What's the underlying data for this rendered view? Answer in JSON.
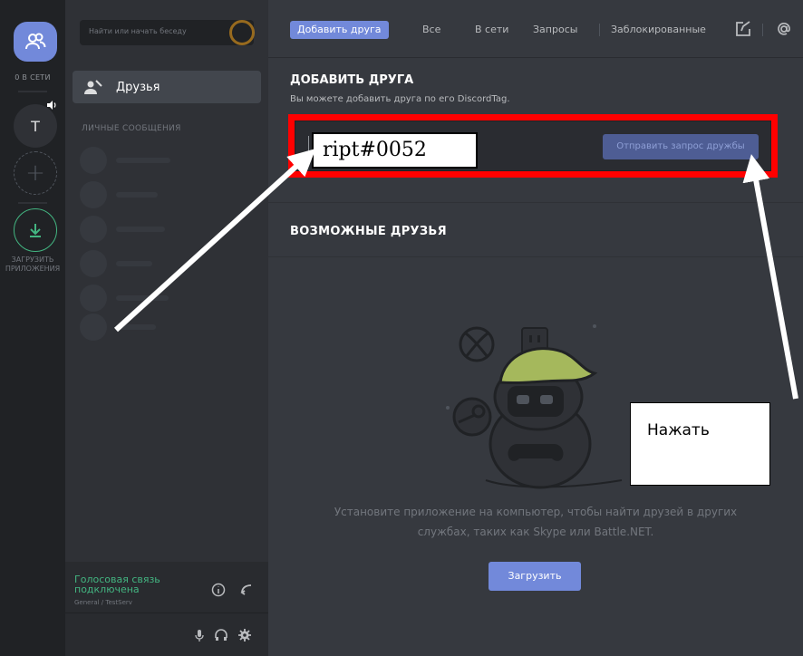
{
  "rail": {
    "online_label": "0 В СЕТИ",
    "server_initial": "T",
    "download_label": "ЗАГРУЗИТЬ ПРИЛОЖЕНИЯ"
  },
  "sidebar": {
    "search_placeholder": "Найти или начать беседу",
    "friends_label": "Друзья",
    "dm_header": "ЛИЧНЫЕ СООБЩЕНИЯ",
    "voice_status": "Голосовая связь подключена",
    "voice_channel": "General / TestServ"
  },
  "tabs": {
    "add_friend": "Добавить друга",
    "all": "Все",
    "online": "В сети",
    "pending": "Запросы",
    "blocked": "Заблокированные"
  },
  "add_friend": {
    "title": "ДОБАВИТЬ ДРУГА",
    "description": "Вы можете добавить друга по его DiscordTag.",
    "input_value": "ript#0052",
    "send_button": "Отправить запрос дружбы"
  },
  "suggestions": {
    "title": "ВОЗМОЖНЫЕ ДРУЗЬЯ",
    "empty_text_line1": "Установите приложение на компьютер, чтобы найти друзей в других",
    "empty_text_line2": "службах, таких как Skype или Battle.NET.",
    "download_button": "Загрузить"
  },
  "annotation": {
    "callout_text": "Нажать"
  },
  "colors": {
    "blurple": "#7289da",
    "highlight_frame": "#ff0000",
    "online_green": "#43b581"
  },
  "icons": [
    "friends-icon",
    "speaker-icon",
    "plus-icon",
    "download-icon",
    "new-dm-icon",
    "at-icon",
    "info-icon",
    "disconnect-icon",
    "mic-icon",
    "headphones-icon",
    "gear-icon"
  ]
}
